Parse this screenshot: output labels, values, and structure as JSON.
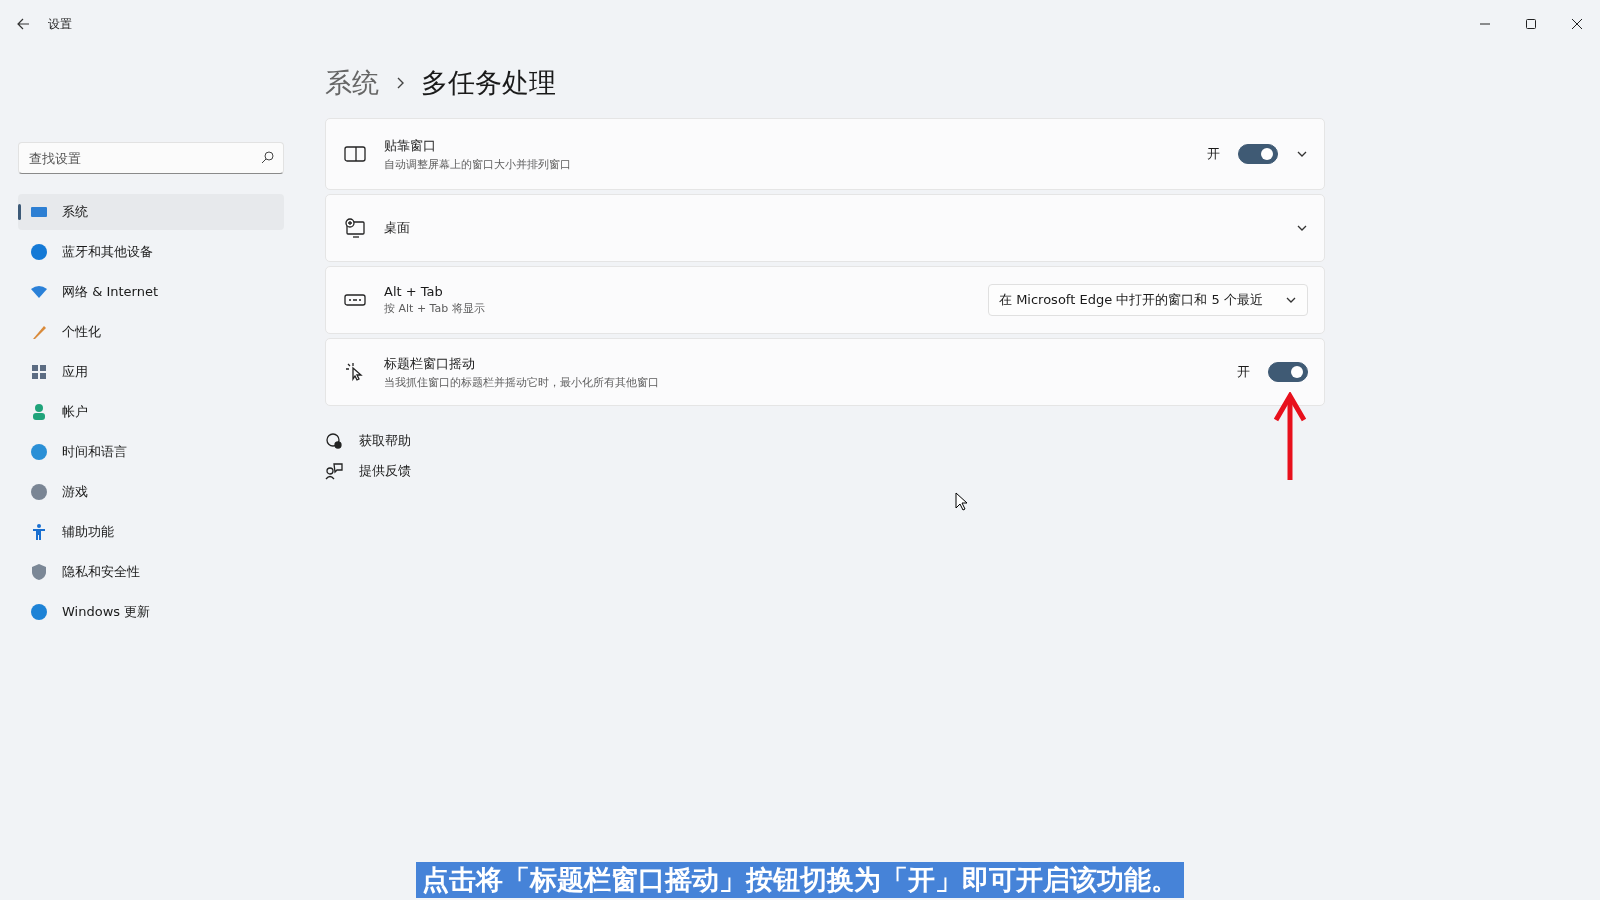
{
  "window": {
    "title": "设置"
  },
  "sidebar": {
    "search": {
      "placeholder": "查找设置"
    },
    "items": [
      {
        "label": "系统",
        "selected": true
      },
      {
        "label": "蓝牙和其他设备",
        "selected": false
      },
      {
        "label": "网络 & Internet",
        "selected": false
      },
      {
        "label": "个性化",
        "selected": false
      },
      {
        "label": "应用",
        "selected": false
      },
      {
        "label": "帐户",
        "selected": false
      },
      {
        "label": "时间和语言",
        "selected": false
      },
      {
        "label": "游戏",
        "selected": false
      },
      {
        "label": "辅助功能",
        "selected": false
      },
      {
        "label": "隐私和安全性",
        "selected": false
      },
      {
        "label": "Windows 更新",
        "selected": false
      }
    ]
  },
  "breadcrumb": [
    "系统",
    "多任务处理"
  ],
  "cards": [
    {
      "kind": "toggle",
      "title": "贴靠窗口",
      "subtitle": "自动调整屏幕上的窗口大小并排列窗口",
      "toggle_label": "开",
      "on": true,
      "expandable": true
    },
    {
      "kind": "plain",
      "title": "桌面",
      "expandable": true
    },
    {
      "kind": "dropdown",
      "title": "Alt + Tab",
      "subtitle": "按 Alt + Tab 将显示",
      "value": "在 Microsoft Edge 中打开的窗口和 5 个最近"
    },
    {
      "kind": "toggle",
      "title": "标题栏窗口摇动",
      "subtitle": "当我抓住窗口的标题栏并摇动它时，最小化所有其他窗口",
      "toggle_label": "开",
      "on": true,
      "expandable": false
    }
  ],
  "links": [
    {
      "label": "获取帮助"
    },
    {
      "label": "提供反馈"
    }
  ],
  "caption": "点击将「标题栏窗口摇动」按钮切换为「开」即可开启该功能。"
}
